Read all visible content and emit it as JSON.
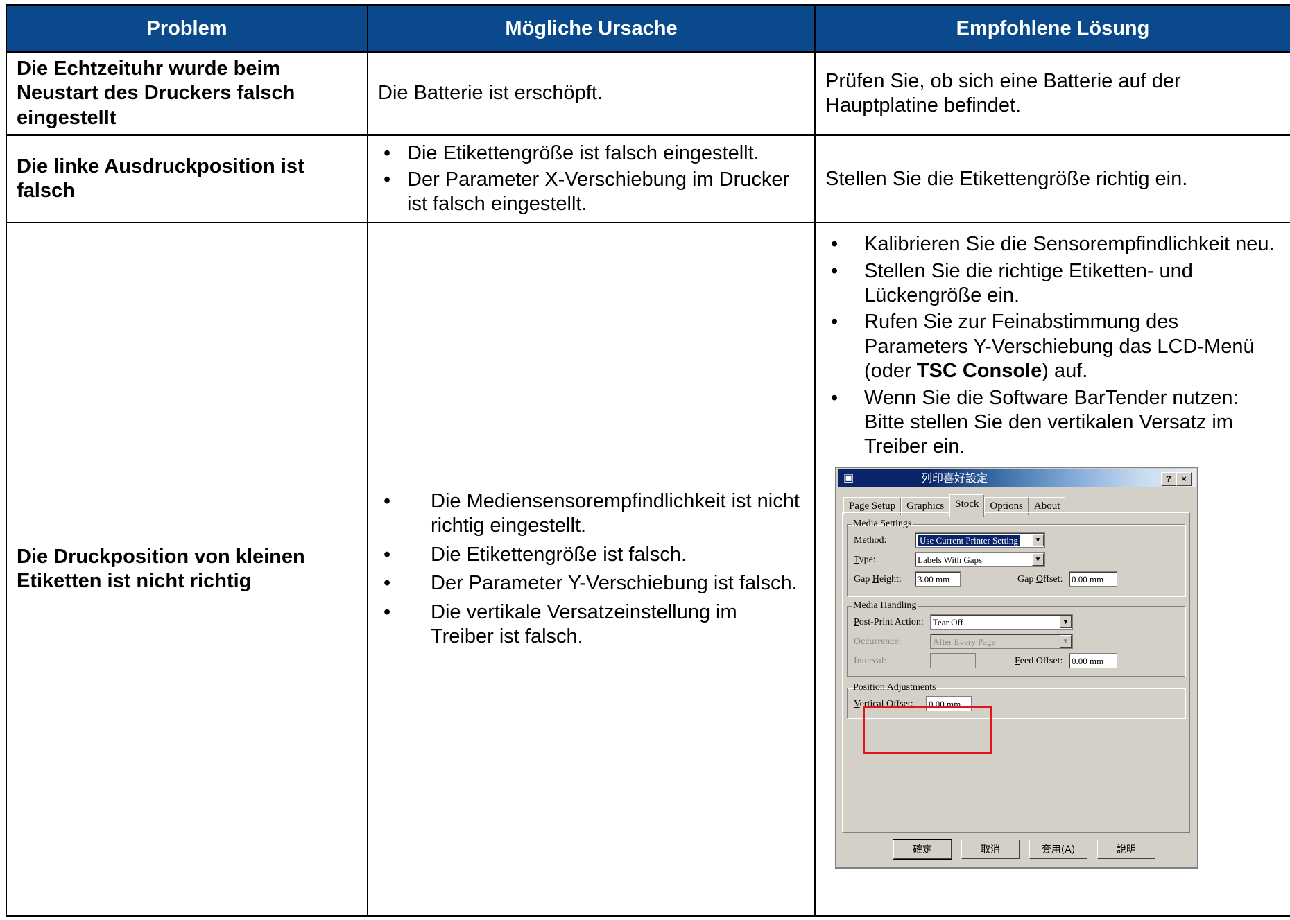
{
  "table": {
    "headers": [
      "Problem",
      "Mögliche Ursache",
      "Empfohlene Lösung"
    ],
    "rows": [
      {
        "problem": "Die Echtzeituhr wurde beim Neustart des Druckers falsch eingestellt",
        "cause": "Die Batterie ist erschöpft.",
        "solution": "Prüfen Sie, ob sich eine Batterie auf der Hauptplatine befindet."
      },
      {
        "problem": "Die linke Ausdruckposition ist falsch",
        "causes": [
          "Die Etikettengröße ist falsch eingestellt.",
          "Der Parameter X-Verschiebung im Drucker ist falsch eingestellt."
        ],
        "solution": "Stellen Sie die Etikettengröße richtig ein."
      },
      {
        "problem": "Die Druckposition von kleinen Etiketten ist nicht richtig",
        "causes": [
          "Die Mediensensorempfindlichkeit ist nicht richtig eingestellt.",
          "Die Etikettengröße ist falsch.",
          "Der Parameter Y-Verschiebung ist falsch.",
          "Die vertikale Versatzeinstellung im Treiber ist falsch."
        ],
        "solutions": {
          "s1": "Kalibrieren Sie die Sensorempfindlichkeit neu.",
          "s2": "Stellen Sie die richtige Etiketten- und Lückengröße ein.",
          "s3_before": "Rufen Sie zur Feinabstimmung des Parameters Y-Verschiebung das LCD-Menü (oder ",
          "s3_bold": "TSC Console",
          "s3_after": ") auf.",
          "s4": "Wenn Sie die Software BarTender nutzen: Bitte stellen Sie den vertikalen Versatz im Treiber ein."
        }
      }
    ]
  },
  "dialog": {
    "title": "列印喜好設定",
    "help_button": "?",
    "close_button": "×",
    "tabs": [
      "Page Setup",
      "Graphics",
      "Stock",
      "Options",
      "About"
    ],
    "active_tab": "Stock",
    "media_settings": {
      "legend": "Media Settings",
      "method_label": "Method:",
      "method_value": "Use Current Printer Setting",
      "type_label": "Type:",
      "type_value": "Labels With Gaps",
      "gap_height_label": "Gap Height:",
      "gap_height_value": "3.00 mm",
      "gap_offset_label": "Gap Offset:",
      "gap_offset_value": "0.00 mm"
    },
    "media_handling": {
      "legend": "Media Handling",
      "post_print_label": "Post-Print Action:",
      "post_print_value": "Tear Off",
      "occurrence_label": "Occurrence:",
      "occurrence_value": "After Every Page",
      "interval_label": "Interval:",
      "interval_value": "",
      "feed_offset_label": "Feed Offset:",
      "feed_offset_value": "0.00 mm"
    },
    "position_adjustments": {
      "legend": "Position Adjustments",
      "vertical_offset_label": "Vertical Offset:",
      "vertical_offset_value": "0.00 mm"
    },
    "buttons": {
      "ok": "確定",
      "cancel": "取消",
      "apply": "套用(A)",
      "help": "說明"
    },
    "highlight_color": "#e0161b"
  },
  "colors": {
    "header_bg": "#0a4a8c",
    "header_text": "#ffffff"
  }
}
